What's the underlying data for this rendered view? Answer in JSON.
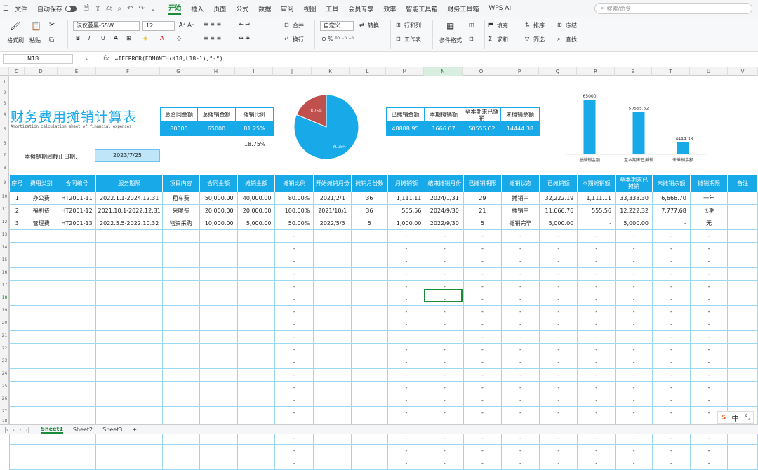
{
  "menubar": {
    "items": [
      "文件",
      "自动保存",
      "开始",
      "插入",
      "页面",
      "公式",
      "数据",
      "审阅",
      "视图",
      "工具",
      "会员专享",
      "效率",
      "智能工具箱",
      "财务工具箱",
      "WPS AI"
    ],
    "active": "开始",
    "search": "搜索/命令"
  },
  "ribbon": {
    "format_painter": "格式刷",
    "paste": "粘贴",
    "font": "汉仪菱黑-55W",
    "size": "12",
    "merge": "合并",
    "wrap": "换行",
    "numfmt": "自定义",
    "convert": "转换",
    "rowcol": "行和列",
    "sheet": "工作表",
    "cond": "条件格式",
    "fill": "填充",
    "sort": "排序",
    "freeze": "冻结",
    "sum": "求和",
    "filter": "筛选",
    "find": "查找"
  },
  "formula": {
    "cell": "N18",
    "fx": "fx",
    "text": "=IFERROR(EOMONTH(K18,L18-1),\"-\")"
  },
  "columns": [
    "C",
    "D",
    "E",
    "F",
    "G",
    "H",
    "I",
    "J",
    "K",
    "L",
    "M",
    "N",
    "O",
    "P",
    "Q",
    "R",
    "S",
    "T",
    "U",
    "V"
  ],
  "rows": [
    "1",
    "2",
    "3",
    "4",
    "5",
    "6",
    "7",
    "8",
    "9",
    "10",
    "11",
    "12",
    "13",
    "14",
    "15",
    "16",
    "17",
    "18",
    "19",
    "20",
    "21",
    "22",
    "23",
    "24",
    "25",
    "26",
    "27",
    "28"
  ],
  "title": "财务费用摊销计算表",
  "subtitle": "Amortization calculation sheet of financial expenses",
  "summary1": {
    "headers": [
      "总合同金额",
      "总摊销金额",
      "摊销比例"
    ],
    "values": [
      "80000",
      "65000",
      "81.25%"
    ],
    "ratio2": "18.75%"
  },
  "summary2": {
    "headers": [
      "已摊销金额",
      "本期摊销额",
      "至本期末已摊销",
      "未摊销余额"
    ],
    "values": [
      "48888.95",
      "1666.67",
      "50555.62",
      "14444.38"
    ]
  },
  "date": {
    "label": "本摊销期间截止日期:",
    "value": "2023/7/25"
  },
  "chart_data": [
    {
      "type": "pie",
      "values": [
        81.25,
        18.75
      ],
      "labels": [
        "81.25%",
        "18.75%"
      ],
      "colors": [
        "#17a9e8",
        "#c0504d"
      ]
    },
    {
      "type": "bar",
      "categories": [
        "总摊销金额",
        "至本期末已摊销",
        "未摊销余额"
      ],
      "values": [
        65000,
        50555.62,
        14444.38
      ],
      "data_labels": [
        "65000",
        "50555.62",
        "14444.38"
      ],
      "color": "#17a9e8"
    }
  ],
  "table": {
    "headers": [
      "序号",
      "费用类别",
      "合同编号",
      "服务期限",
      "项目内容",
      "合同金额",
      "摊销金额",
      "摊销比例",
      "开始摊销月份",
      "摊销月份数",
      "月摊销额",
      "结束摊销月份",
      "已摊销期限",
      "摊销状态",
      "已摊销额",
      "本期摊销额",
      "至本期末已摊销",
      "未摊销余额",
      "摊销期限",
      "备注"
    ],
    "rows": [
      [
        "1",
        "办公费",
        "HT2001-11",
        "2022.1.1-2024.12.31",
        "租车费",
        "50,000.00",
        "40,000.00",
        "80.00%",
        "2021/2/1",
        "36",
        "1,111.11",
        "2024/1/31",
        "29",
        "摊销中",
        "32,222.19",
        "1,111.11",
        "33,333.30",
        "6,666.70",
        "一年",
        ""
      ],
      [
        "2",
        "福利费",
        "HT2001-12",
        "2021.10.1-2022.12.31",
        "采暖费",
        "20,000.00",
        "20,000.00",
        "100.00%",
        "2021/10/1",
        "36",
        "555.56",
        "2024/9/30",
        "21",
        "摊销中",
        "11,666.76",
        "555.56",
        "12,222.32",
        "7,777.68",
        "长期",
        ""
      ],
      [
        "3",
        "管理费",
        "HT2001-13",
        "2022.5.5-2022.10.32",
        "物资采购",
        "10,000.00",
        "5,000.00",
        "50.00%",
        "2022/5/5",
        "5",
        "1,000.00",
        "2022/9/30",
        "5",
        "摊销完毕",
        "5,000.00",
        "-",
        "5,000.00",
        "-",
        "无",
        ""
      ]
    ],
    "dash": "-"
  },
  "sheets": [
    "Sheet1",
    "Sheet2",
    "Sheet3"
  ],
  "active_sheet": "Sheet1",
  "ime": {
    "logo": "S",
    "lang": "中"
  }
}
